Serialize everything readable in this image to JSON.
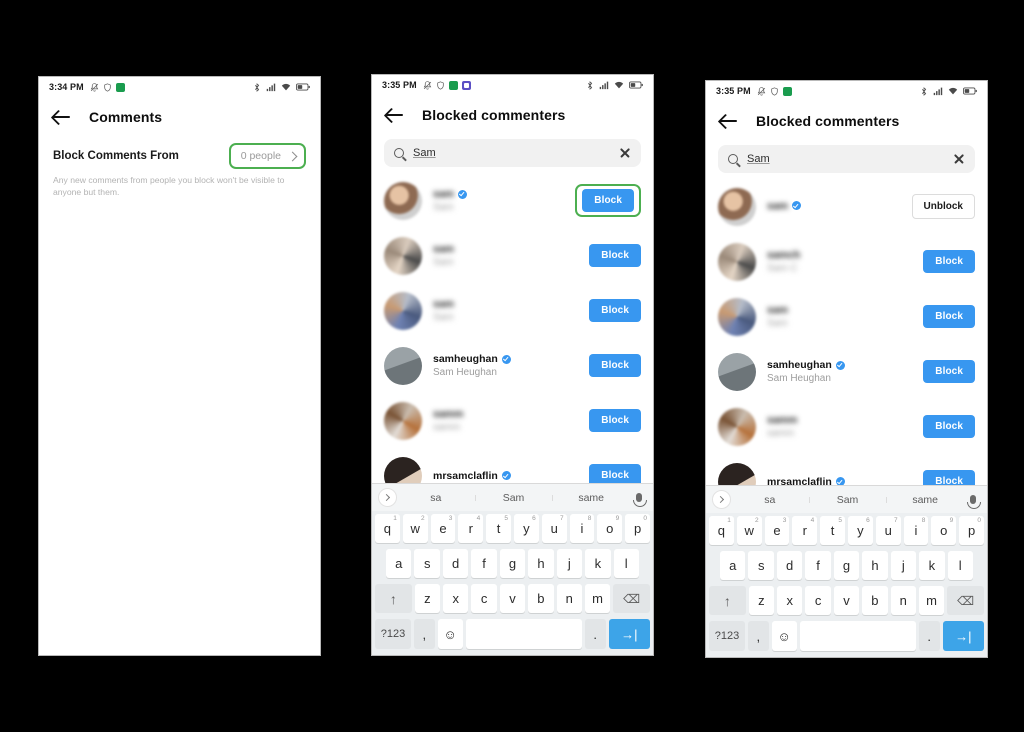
{
  "phones": [
    {
      "id": "comments-settings",
      "statusbar": {
        "time": "3:34 PM",
        "left_icons": [
          "bell-off-icon",
          "shield-icon",
          "green-app-icon"
        ],
        "right_icons": [
          "bluetooth-icon",
          "signal-icon",
          "wifi-icon",
          "battery-icon"
        ]
      },
      "appbar": {
        "back": "back-arrow",
        "title": "Comments"
      },
      "setting": {
        "label": "Block Comments From",
        "value": "0 people",
        "help": "Any new comments from people you block won't be visible to anyone but them.",
        "highlighted": true
      }
    },
    {
      "id": "blocked-commenters-search",
      "statusbar": {
        "time": "3:35 PM",
        "left_icons": [
          "bell-off-icon",
          "shield-icon",
          "green-app-icon",
          "purple-app-icon"
        ],
        "right_icons": [
          "bluetooth-icon",
          "signal-icon",
          "wifi-icon",
          "battery-icon"
        ]
      },
      "appbar": {
        "back": "back-arrow",
        "title": "Blocked commenters"
      },
      "search": {
        "value": "Sam",
        "placeholder": "Search",
        "clear": "clear-icon"
      },
      "rows": [
        {
          "username": "sam",
          "fullname": "Sam",
          "verified": true,
          "blurred": true,
          "action": "Block",
          "highlighted": true,
          "avatar": "av1"
        },
        {
          "username": "sam",
          "fullname": "Sam",
          "verified": false,
          "blurred": true,
          "action": "Block",
          "highlighted": false,
          "avatar": "av2"
        },
        {
          "username": "sam",
          "fullname": "Sam",
          "verified": false,
          "blurred": true,
          "action": "Block",
          "highlighted": false,
          "avatar": "av3"
        },
        {
          "username": "samheughan",
          "fullname": "Sam Heughan",
          "verified": true,
          "blurred": false,
          "action": "Block",
          "highlighted": false,
          "avatar": "av4"
        },
        {
          "username": "samm",
          "fullname": "samm",
          "verified": false,
          "blurred": true,
          "action": "Block",
          "highlighted": false,
          "avatar": "av5"
        },
        {
          "username": "mrsamclaflin",
          "fullname": "",
          "verified": true,
          "blurred": false,
          "action": "Block",
          "highlighted": false,
          "avatar": "av6"
        }
      ],
      "keyboard": {
        "suggestions": [
          "sa",
          "Sam",
          "same"
        ],
        "toggle": "chevron-right-icon",
        "mic": "microphone-icon",
        "row1": [
          {
            "k": "q",
            "n": "1"
          },
          {
            "k": "w",
            "n": "2"
          },
          {
            "k": "e",
            "n": "3"
          },
          {
            "k": "r",
            "n": "4"
          },
          {
            "k": "t",
            "n": "5"
          },
          {
            "k": "y",
            "n": "6"
          },
          {
            "k": "u",
            "n": "7"
          },
          {
            "k": "i",
            "n": "8"
          },
          {
            "k": "o",
            "n": "9"
          },
          {
            "k": "p",
            "n": "0"
          }
        ],
        "row2": [
          "a",
          "s",
          "d",
          "f",
          "g",
          "h",
          "j",
          "k",
          "l"
        ],
        "row3": [
          "z",
          "x",
          "c",
          "v",
          "b",
          "n",
          "m"
        ],
        "shift": "shift-icon",
        "backspace": "backspace-icon",
        "numeric": "?123",
        "comma": ",",
        "emoji": "emoji-icon",
        "space": "",
        "period": ".",
        "enter": "enter-icon"
      }
    },
    {
      "id": "blocked-commenters-unblock",
      "statusbar": {
        "time": "3:35 PM",
        "left_icons": [
          "bell-off-icon",
          "shield-icon",
          "green-app-icon"
        ],
        "right_icons": [
          "bluetooth-icon",
          "signal-icon",
          "wifi-icon",
          "battery-icon"
        ]
      },
      "appbar": {
        "back": "back-arrow",
        "title": "Blocked commenters"
      },
      "search": {
        "value": "Sam",
        "placeholder": "Search",
        "clear": "clear-icon"
      },
      "rows": [
        {
          "username": "sam",
          "fullname": "",
          "verified": true,
          "blurred": true,
          "action": "Unblock",
          "highlighted": false,
          "avatar": "av1"
        },
        {
          "username": "samch",
          "fullname": "Sam C",
          "verified": false,
          "blurred": true,
          "action": "Block",
          "highlighted": false,
          "avatar": "av2"
        },
        {
          "username": "sam",
          "fullname": "Sam",
          "verified": false,
          "blurred": true,
          "action": "Block",
          "highlighted": false,
          "avatar": "av3"
        },
        {
          "username": "samheughan",
          "fullname": "Sam Heughan",
          "verified": true,
          "blurred": false,
          "action": "Block",
          "highlighted": false,
          "avatar": "av4"
        },
        {
          "username": "samm",
          "fullname": "samm",
          "verified": false,
          "blurred": true,
          "action": "Block",
          "highlighted": false,
          "avatar": "av5"
        },
        {
          "username": "mrsamclaflin",
          "fullname": "",
          "verified": true,
          "blurred": false,
          "action": "Block",
          "highlighted": false,
          "avatar": "av6"
        }
      ],
      "keyboard": {
        "suggestions": [
          "sa",
          "Sam",
          "same"
        ],
        "toggle": "chevron-right-icon",
        "mic": "microphone-icon",
        "row1": [
          {
            "k": "q",
            "n": "1"
          },
          {
            "k": "w",
            "n": "2"
          },
          {
            "k": "e",
            "n": "3"
          },
          {
            "k": "r",
            "n": "4"
          },
          {
            "k": "t",
            "n": "5"
          },
          {
            "k": "y",
            "n": "6"
          },
          {
            "k": "u",
            "n": "7"
          },
          {
            "k": "i",
            "n": "8"
          },
          {
            "k": "o",
            "n": "9"
          },
          {
            "k": "p",
            "n": "0"
          }
        ],
        "row2": [
          "a",
          "s",
          "d",
          "f",
          "g",
          "h",
          "j",
          "k",
          "l"
        ],
        "row3": [
          "z",
          "x",
          "c",
          "v",
          "b",
          "n",
          "m"
        ],
        "shift": "shift-icon",
        "backspace": "backspace-icon",
        "numeric": "?123",
        "comma": ",",
        "emoji": "emoji-icon",
        "space": "",
        "period": ".",
        "enter": "enter-icon"
      }
    }
  ],
  "colors": {
    "accent_blue": "#3897f0",
    "highlight_green": "#4caf50",
    "background": "#000000",
    "enter_key": "#3da4e8"
  }
}
